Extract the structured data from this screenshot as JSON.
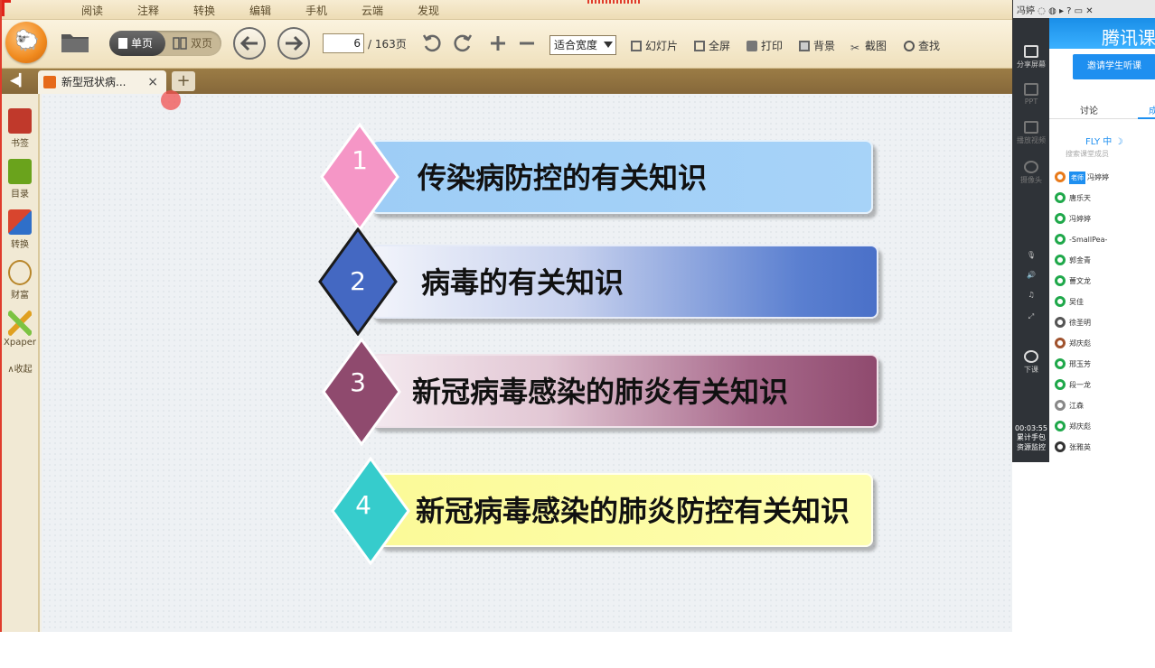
{
  "menu": [
    "阅读",
    "注释",
    "转换",
    "编辑",
    "手机",
    "云端",
    "发现"
  ],
  "toolbar": {
    "single_page": "单页",
    "double_page": "双页",
    "current_page": "6",
    "total_pages": "/ 163页",
    "zoom": "适合宽度",
    "slideshow": "幻灯片",
    "fullscreen": "全屏",
    "print": "打印",
    "background": "背景",
    "screenshot": "截图",
    "find": "查找"
  },
  "tab": {
    "title": "新型冠状病...",
    "close": "×",
    "add": "+"
  },
  "sidebar": [
    {
      "label": "书签",
      "color": "#c0392b"
    },
    {
      "label": "目录",
      "color": "#6aa31c"
    },
    {
      "label": "转换",
      "color": "#d8452e"
    },
    {
      "label": "财富",
      "color": "#b8862a"
    },
    {
      "label": "Xpaper",
      "color": "#e0a020"
    }
  ],
  "sidebar_collapse": "收起",
  "slide": {
    "items": [
      {
        "num": "1",
        "text": "传染病防控的有关知识",
        "diamond": "#f596c6",
        "bar": "#9ecdf6"
      },
      {
        "num": "2",
        "text": "病毒的有关知识",
        "diamond": "#4468c2",
        "bar": "#5a7fd0"
      },
      {
        "num": "3",
        "text": "新冠病毒感染的肺炎有关知识",
        "diamond": "#8f4a6e",
        "bar": "#8f4a6e"
      },
      {
        "num": "4",
        "text": "新冠病毒感染的肺炎防控有关知识",
        "diamond": "#36cccc",
        "bar": "#fbfa98"
      }
    ]
  },
  "right_panel": {
    "top_user": "冯婷",
    "brand": "腾讯课",
    "left_items": [
      "分享屏幕",
      "PPT",
      "播放视频",
      "摄像头",
      "下课"
    ],
    "invite": "邀请学生听课",
    "tab_discuss": "讨论",
    "tab_members": "成",
    "fly_bar": "FLY 中 ☽",
    "search_placeholder": "搜索课堂成员",
    "teacher_tag": "老师",
    "members": [
      "冯婷婷",
      "唐乐天",
      "冯婷婷",
      "-SmallPea-",
      "郭金青",
      "蓸文龙",
      "吴佳",
      "徐圣明",
      "郑庆彪",
      "邢玉芳",
      "段一龙",
      "江森",
      "郑庆彪",
      "张雅英"
    ],
    "time": "00:03:55",
    "time_label": "累计手包",
    "monitor": "资源监控"
  }
}
